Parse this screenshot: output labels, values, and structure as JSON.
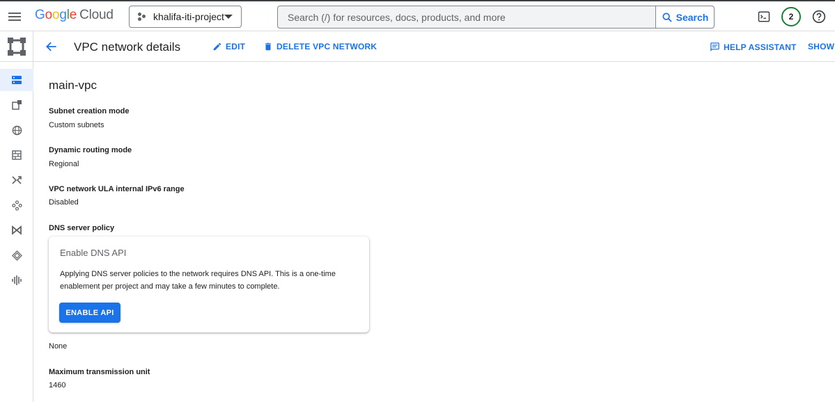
{
  "topbar": {
    "logo_google": [
      "G",
      "o",
      "o",
      "g",
      "l",
      "e"
    ],
    "logo_cloud": "Cloud",
    "project_name": "khalifa-iti-project",
    "search_placeholder": "Search (/) for resources, docs, products, and more",
    "search_button": "Search",
    "notifications_count": "2"
  },
  "rail": {
    "items": [
      "network-overview-icon",
      "vpc-networks-icon",
      "ip-addresses-icon",
      "firewall-icon",
      "routes-icon",
      "network-connectivity-icon",
      "vpc-peering-icon",
      "shared-vpc-icon",
      "packet-mirroring-icon"
    ]
  },
  "header": {
    "title": "VPC network details",
    "edit": "EDIT",
    "delete": "DELETE VPC NETWORK",
    "help_assistant": "HELP ASSISTANT",
    "show_panel": "SHOW I"
  },
  "details": {
    "network_name": "main-vpc",
    "subnet_mode_label": "Subnet creation mode",
    "subnet_mode_value": "Custom subnets",
    "routing_label": "Dynamic routing mode",
    "routing_value": "Regional",
    "ipv6_label": "VPC network ULA internal IPv6 range",
    "ipv6_value": "Disabled",
    "dns_label": "DNS server policy",
    "dns_value": "None",
    "mtu_label": "Maximum transmission unit",
    "mtu_value": "1460"
  },
  "dns_card": {
    "title": "Enable DNS API",
    "body": "Applying DNS server policies to the network requires DNS API. This is a one-time enablement per project and may take a few minutes to complete.",
    "button": "ENABLE API"
  },
  "colors": {
    "accent": "#1a73e8",
    "active_rail_bg": "#e8f0fe",
    "notification_ring": "#188038"
  }
}
